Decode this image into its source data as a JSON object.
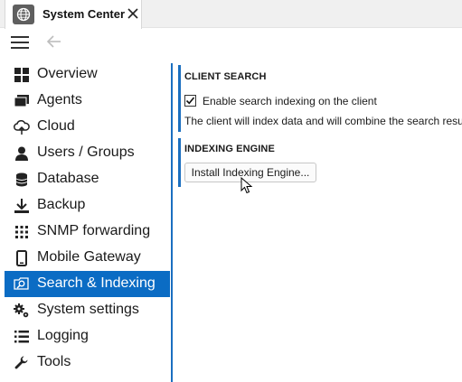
{
  "window": {
    "title": "System Center",
    "app_icon": "globe-icon",
    "close_icon": "close-icon"
  },
  "toolbar": {
    "menu_icon": "hamburger-icon",
    "back_icon": "back-arrow-icon"
  },
  "sidebar": {
    "items": [
      {
        "label": "Overview",
        "icon": "grid-icon",
        "active": false
      },
      {
        "label": "Agents",
        "icon": "agents-icon",
        "active": false
      },
      {
        "label": "Cloud",
        "icon": "cloud-icon",
        "active": false
      },
      {
        "label": "Users / Groups",
        "icon": "user-icon",
        "active": false
      },
      {
        "label": "Database",
        "icon": "database-icon",
        "active": false
      },
      {
        "label": "Backup",
        "icon": "download-icon",
        "active": false
      },
      {
        "label": "SNMP forwarding",
        "icon": "snmp-icon",
        "active": false
      },
      {
        "label": "Mobile Gateway",
        "icon": "mobile-icon",
        "active": false
      },
      {
        "label": "Search & Indexing",
        "icon": "search-folder-icon",
        "active": true
      },
      {
        "label": "System settings",
        "icon": "gears-icon",
        "active": false
      },
      {
        "label": "Logging",
        "icon": "list-icon",
        "active": false
      },
      {
        "label": "Tools",
        "icon": "wrench-icon",
        "active": false
      }
    ],
    "active_color": "#0b6cc4"
  },
  "client_search": {
    "title": "CLIENT SEARCH",
    "checkbox_label": "Enable search indexing on the client",
    "checkbox_checked": true,
    "description": "The client will index data and will combine the search resu"
  },
  "indexing_engine": {
    "title": "INDEXING ENGINE",
    "button_label": "Install Indexing Engine..."
  },
  "colors": {
    "accent": "#1b6fc0"
  }
}
